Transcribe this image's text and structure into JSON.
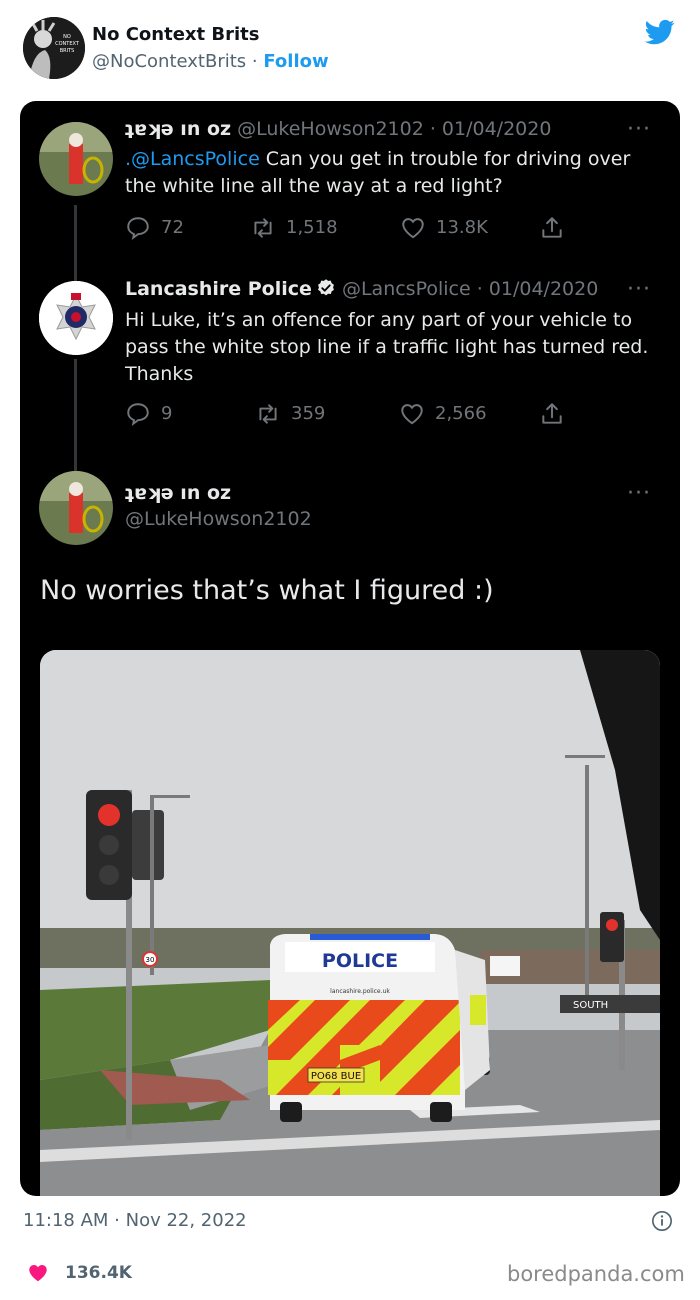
{
  "outer": {
    "author_name": "No Context Brits",
    "handle": "@NoContextBrits",
    "separator": " · ",
    "follow_label": "Follow",
    "avatar_label_lines": [
      "NO",
      "CONTEXT",
      "BRITS"
    ],
    "timestamp": "11:18 AM · Nov 22, 2022",
    "likes": "136.4K",
    "brand_color": "#1d9bf0",
    "like_color": "#f91880"
  },
  "thread": {
    "tweet1": {
      "name": "ʇɐʞǝ ın oz",
      "handle_date": "@LukeHowson2102 · 01/04/2020",
      "mention": ".@LancsPolice",
      "text": " Can you get in trouble for driving over the white line all the way at a red light?",
      "replies": "72",
      "retweets": "1,518",
      "likes": "13.8K"
    },
    "tweet2": {
      "name": "Lancashire Police",
      "handle_date": "@LancsPolice · 01/04/2020",
      "text": "Hi Luke, it’s an offence for any part of your vehicle to pass the white stop line if a traffic light has turned red. Thanks",
      "replies": "9",
      "retweets": "359",
      "likes": "2,566"
    },
    "tweet3": {
      "name": "ʇɐʞǝ ın oz",
      "handle": "@LukeHowson2102",
      "text": "No worries that’s what I figured :)"
    },
    "more_icon": "···"
  },
  "photo": {
    "van_label": "POLICE",
    "van_url": "lancashire.police.uk",
    "plate": "PO68 BUE",
    "road_sign": "SOUTH",
    "junction_sign": "30"
  },
  "watermark": "boredpanda.com"
}
